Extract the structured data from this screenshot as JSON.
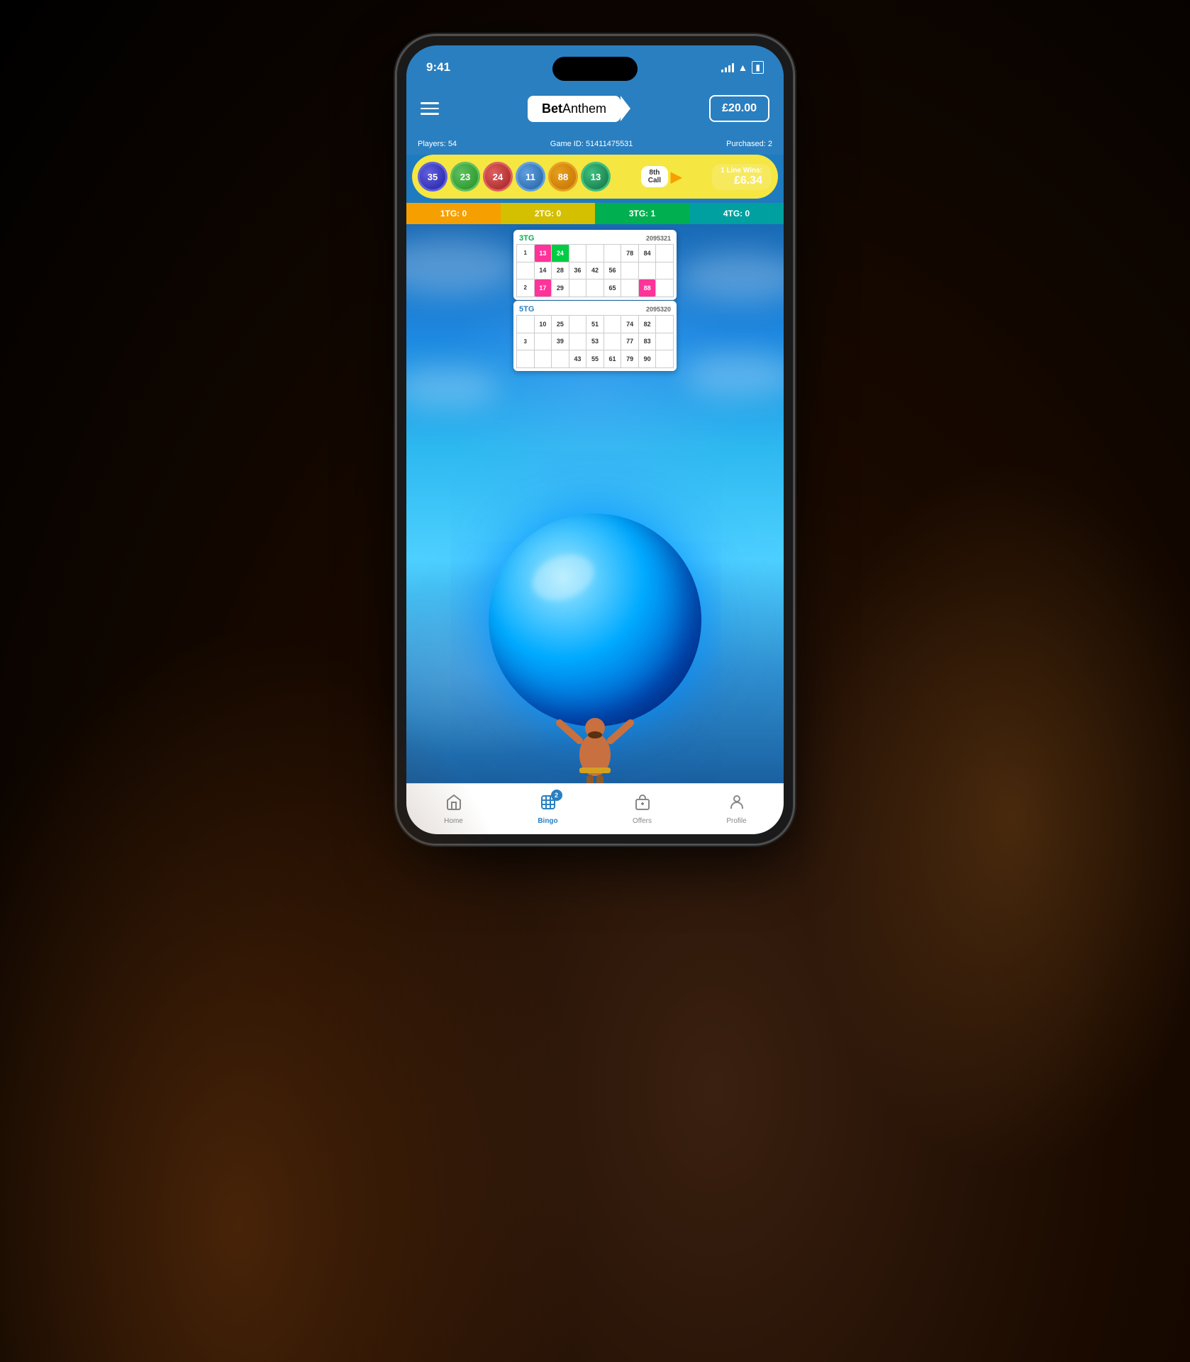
{
  "scene": {
    "bg_color": "#000"
  },
  "status_bar": {
    "time": "9:41",
    "signal": "signal",
    "wifi": "wifi",
    "battery": "battery"
  },
  "header": {
    "menu_label": "menu",
    "brand_bold": "Bet",
    "brand_light": "Anthem",
    "balance": "£20.00"
  },
  "game_info": {
    "players_label": "Players:",
    "players_value": "54",
    "game_id_label": "Game ID:",
    "game_id_value": "51411475531",
    "purchased_label": "Purchased:",
    "purchased_value": "2"
  },
  "call_display": {
    "balls": [
      {
        "number": "35",
        "class": "ball-35"
      },
      {
        "number": "23",
        "class": "ball-23"
      },
      {
        "number": "24",
        "class": "ball-24"
      },
      {
        "number": "11",
        "class": "ball-11"
      },
      {
        "number": "88",
        "class": "ball-88"
      },
      {
        "number": "13",
        "class": "ball-13"
      }
    ],
    "call_number": "8th",
    "call_label": "Call",
    "line_wins_label": "1 Line Wins:",
    "line_wins_amount": "£6.34"
  },
  "tg_row": [
    {
      "label": "1TG: 0",
      "style": "orange"
    },
    {
      "label": "2TG: 0",
      "style": "yellow"
    },
    {
      "label": "3TG: 1",
      "style": "green"
    },
    {
      "label": "4TG: 0",
      "style": "teal"
    }
  ],
  "card_3tg": {
    "label": "3TG",
    "id": "2095321",
    "rows": [
      [
        "1",
        "13*",
        "24*",
        "",
        "",
        "",
        "78",
        "84",
        ""
      ],
      [
        "",
        "14",
        "28",
        "36",
        "42",
        "56",
        "",
        "",
        ""
      ],
      [
        "2",
        "17*",
        "29",
        "",
        "",
        "65",
        "",
        "88*",
        ""
      ]
    ]
  },
  "card_5tg": {
    "label": "5TG",
    "id": "2095320",
    "rows": [
      [
        "",
        "10",
        "25",
        "",
        "51",
        "",
        "74",
        "82",
        ""
      ],
      [
        "3",
        "",
        "39",
        "",
        "53",
        "",
        "77",
        "83",
        ""
      ],
      [
        "",
        "",
        "",
        "43",
        "55",
        "61",
        "79",
        "90",
        ""
      ]
    ]
  },
  "bottom_nav": {
    "items": [
      {
        "icon": "home",
        "label": "Home",
        "active": false,
        "badge": null
      },
      {
        "icon": "bingo",
        "label": "Bingo",
        "active": true,
        "badge": "2"
      },
      {
        "icon": "gift",
        "label": "Offers",
        "active": false,
        "badge": null
      },
      {
        "icon": "person",
        "label": "Profile",
        "active": false,
        "badge": null
      }
    ]
  }
}
